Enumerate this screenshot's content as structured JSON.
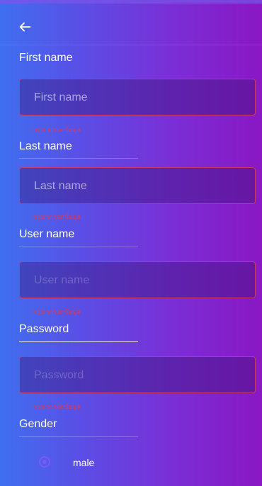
{
  "header": {
    "back_icon": "arrow-left-icon"
  },
  "form": {
    "first_name": {
      "label": "First name",
      "placeholder": "First name",
      "value": "",
      "error": "กรุณากรอกข้อมูล"
    },
    "last_name": {
      "label": "Last name",
      "placeholder": "Last name",
      "value": "",
      "error": "กรุณากรอกข้อมูล"
    },
    "user_name": {
      "label": "User name",
      "placeholder": "User name",
      "value": "",
      "error": "กรุณากรอกข้อมูล"
    },
    "password": {
      "label": "Password",
      "placeholder": "Password",
      "value": "",
      "error": "กรุณากรอกข้อมูล"
    },
    "gender": {
      "label": "Gender",
      "option_label": "male",
      "selected": true
    }
  },
  "colors": {
    "error": "#d63d5c",
    "radio": "#7a5af8",
    "field_border": "#c83b63"
  }
}
